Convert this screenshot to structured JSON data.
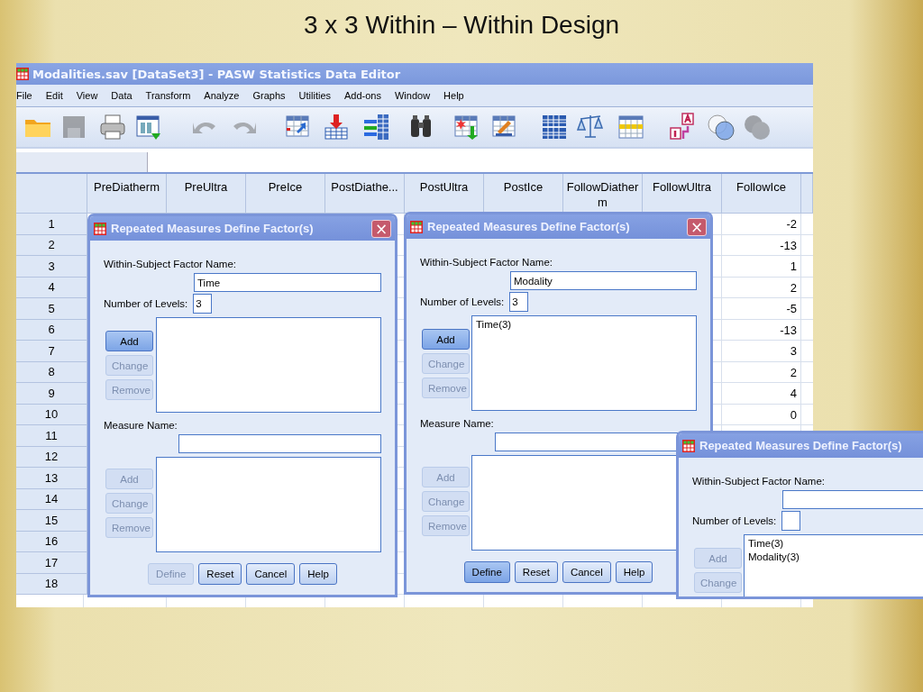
{
  "slide_title": "3 x 3 Within – Within Design",
  "editor": {
    "title": "Modalities.sav [DataSet3] - PASW Statistics Data Editor",
    "menu": [
      "File",
      "Edit",
      "View",
      "Data",
      "Transform",
      "Analyze",
      "Graphs",
      "Utilities",
      "Add-ons",
      "Window",
      "Help"
    ],
    "toolbar": [
      {
        "disabled": false
      },
      {
        "disabled": true
      },
      {
        "disabled": false
      },
      {
        "disabled": false
      },
      {
        "disabled": true
      },
      {
        "disabled": true
      },
      {
        "disabled": false
      },
      {
        "disabled": false
      },
      {
        "disabled": false
      },
      {
        "disabled": false
      },
      {
        "disabled": false
      },
      {
        "disabled": false
      },
      {
        "disabled": false
      },
      {
        "disabled": false
      },
      {
        "disabled": false
      },
      {
        "disabled": false
      },
      {
        "disabled": false
      },
      {
        "disabled": true
      }
    ],
    "columns": [
      "PreDiatherm",
      "PreUltra",
      "PreIce",
      "PostDiathe...",
      "PostUltra",
      "PostIce",
      "FollowDiatherm",
      "FollowUltra",
      "FollowIce"
    ],
    "rows": [
      {
        "number": "1",
        "follow_ice": "-2"
      },
      {
        "number": "2",
        "follow_ice": "-13"
      },
      {
        "number": "3",
        "follow_ice": "1"
      },
      {
        "number": "4",
        "follow_ice": "2"
      },
      {
        "number": "5",
        "follow_ice": "-5"
      },
      {
        "number": "6",
        "follow_ice": "-13"
      },
      {
        "number": "7",
        "follow_ice": "3"
      },
      {
        "number": "8",
        "follow_ice": "2"
      },
      {
        "number": "9",
        "follow_ice": "4"
      },
      {
        "number": "10",
        "follow_ice": "0"
      },
      {
        "number": "11"
      },
      {
        "number": "12"
      },
      {
        "number": "13"
      },
      {
        "number": "14"
      },
      {
        "number": "15"
      },
      {
        "number": "16"
      },
      {
        "number": "17"
      },
      {
        "number": "18"
      }
    ]
  },
  "dialogs": [
    {
      "title": "Repeated Measures Define Factor(s)",
      "close": "×",
      "factor_label": "Within-Subject Factor Name:",
      "factor_value": "Time",
      "levels_label": "Number of Levels:",
      "levels_value": "3",
      "factor_buttons": [
        {
          "label": "Add",
          "disabled": false,
          "default": true
        },
        {
          "label": "Change",
          "disabled": true,
          "default": false
        },
        {
          "label": "Remove",
          "disabled": true,
          "default": false
        }
      ],
      "measure_label": "Measure Name:",
      "measure_buttons": [
        {
          "label": "Add",
          "disabled": true,
          "default": false
        },
        {
          "label": "Change",
          "disabled": true,
          "default": false
        },
        {
          "label": "Remove",
          "disabled": true,
          "default": false
        }
      ],
      "footer_buttons": [
        {
          "label": "Define",
          "disabled": true,
          "default": false
        },
        {
          "label": "Reset",
          "disabled": false,
          "default": false
        },
        {
          "label": "Cancel",
          "disabled": false,
          "default": false
        },
        {
          "label": "Help",
          "disabled": false,
          "default": false
        }
      ]
    },
    {
      "title": "Repeated Measures Define Factor(s)",
      "close": "×",
      "factor_label": "Within-Subject Factor Name:",
      "factor_value": "Modality",
      "levels_label": "Number of Levels:",
      "levels_value": "3",
      "factor_list": [
        "Time(3)"
      ],
      "factor_buttons": [
        {
          "label": "Add",
          "disabled": false,
          "default": true
        },
        {
          "label": "Change",
          "disabled": true,
          "default": false
        },
        {
          "label": "Remove",
          "disabled": true,
          "default": false
        }
      ],
      "measure_label": "Measure Name:",
      "measure_buttons": [
        {
          "label": "Add",
          "disabled": true,
          "default": false
        },
        {
          "label": "Change",
          "disabled": true,
          "default": false
        },
        {
          "label": "Remove",
          "disabled": true,
          "default": false
        }
      ],
      "footer_buttons": [
        {
          "label": "Define",
          "disabled": false,
          "default": true
        },
        {
          "label": "Reset",
          "disabled": false,
          "default": false
        },
        {
          "label": "Cancel",
          "disabled": false,
          "default": false
        },
        {
          "label": "Help",
          "disabled": false,
          "default": false
        }
      ]
    },
    {
      "title": "Repeated Measures Define Factor(s)",
      "factor_label": "Within-Subject Factor Name:",
      "levels_label": "Number of Levels:",
      "factor_list": [
        "Time(3)",
        "Modality(3)"
      ],
      "factor_buttons": [
        {
          "label": "Add",
          "disabled": true,
          "default": false
        },
        {
          "label": "Change",
          "disabled": true,
          "default": false
        }
      ]
    }
  ]
}
